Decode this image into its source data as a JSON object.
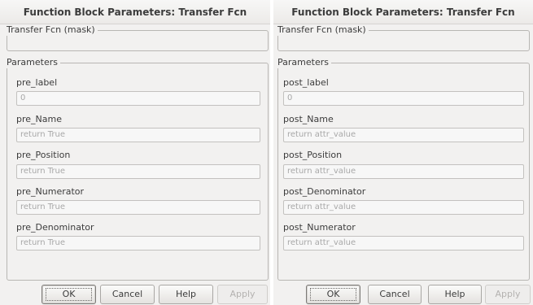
{
  "left_dialog": {
    "title": "Function Block Parameters: Transfer Fcn",
    "mask_group": "Transfer Fcn (mask)",
    "params_group": "Parameters",
    "params": [
      {
        "name": "pre_label",
        "value": "0"
      },
      {
        "name": "pre_Name",
        "value": "return True"
      },
      {
        "name": "pre_Position",
        "value": "return True"
      },
      {
        "name": "pre_Numerator",
        "value": "return True"
      },
      {
        "name": "pre_Denominator",
        "value": "return True"
      }
    ],
    "buttons": {
      "ok": "OK",
      "cancel": "Cancel",
      "help": "Help",
      "apply": "Apply"
    }
  },
  "right_dialog": {
    "title": "Function Block Parameters: Transfer Fcn",
    "mask_group": "Transfer Fcn (mask)",
    "params_group": "Parameters",
    "params": [
      {
        "name": "post_label",
        "value": "0"
      },
      {
        "name": "post_Name",
        "value": "return attr_value"
      },
      {
        "name": "post_Position",
        "value": "return attr_value"
      },
      {
        "name": "post_Denominator",
        "value": "return attr_value"
      },
      {
        "name": "post_Numerator",
        "value": "return attr_value"
      }
    ],
    "buttons": {
      "ok": "OK",
      "cancel": "Cancel",
      "help": "Help",
      "apply": "Apply"
    }
  }
}
